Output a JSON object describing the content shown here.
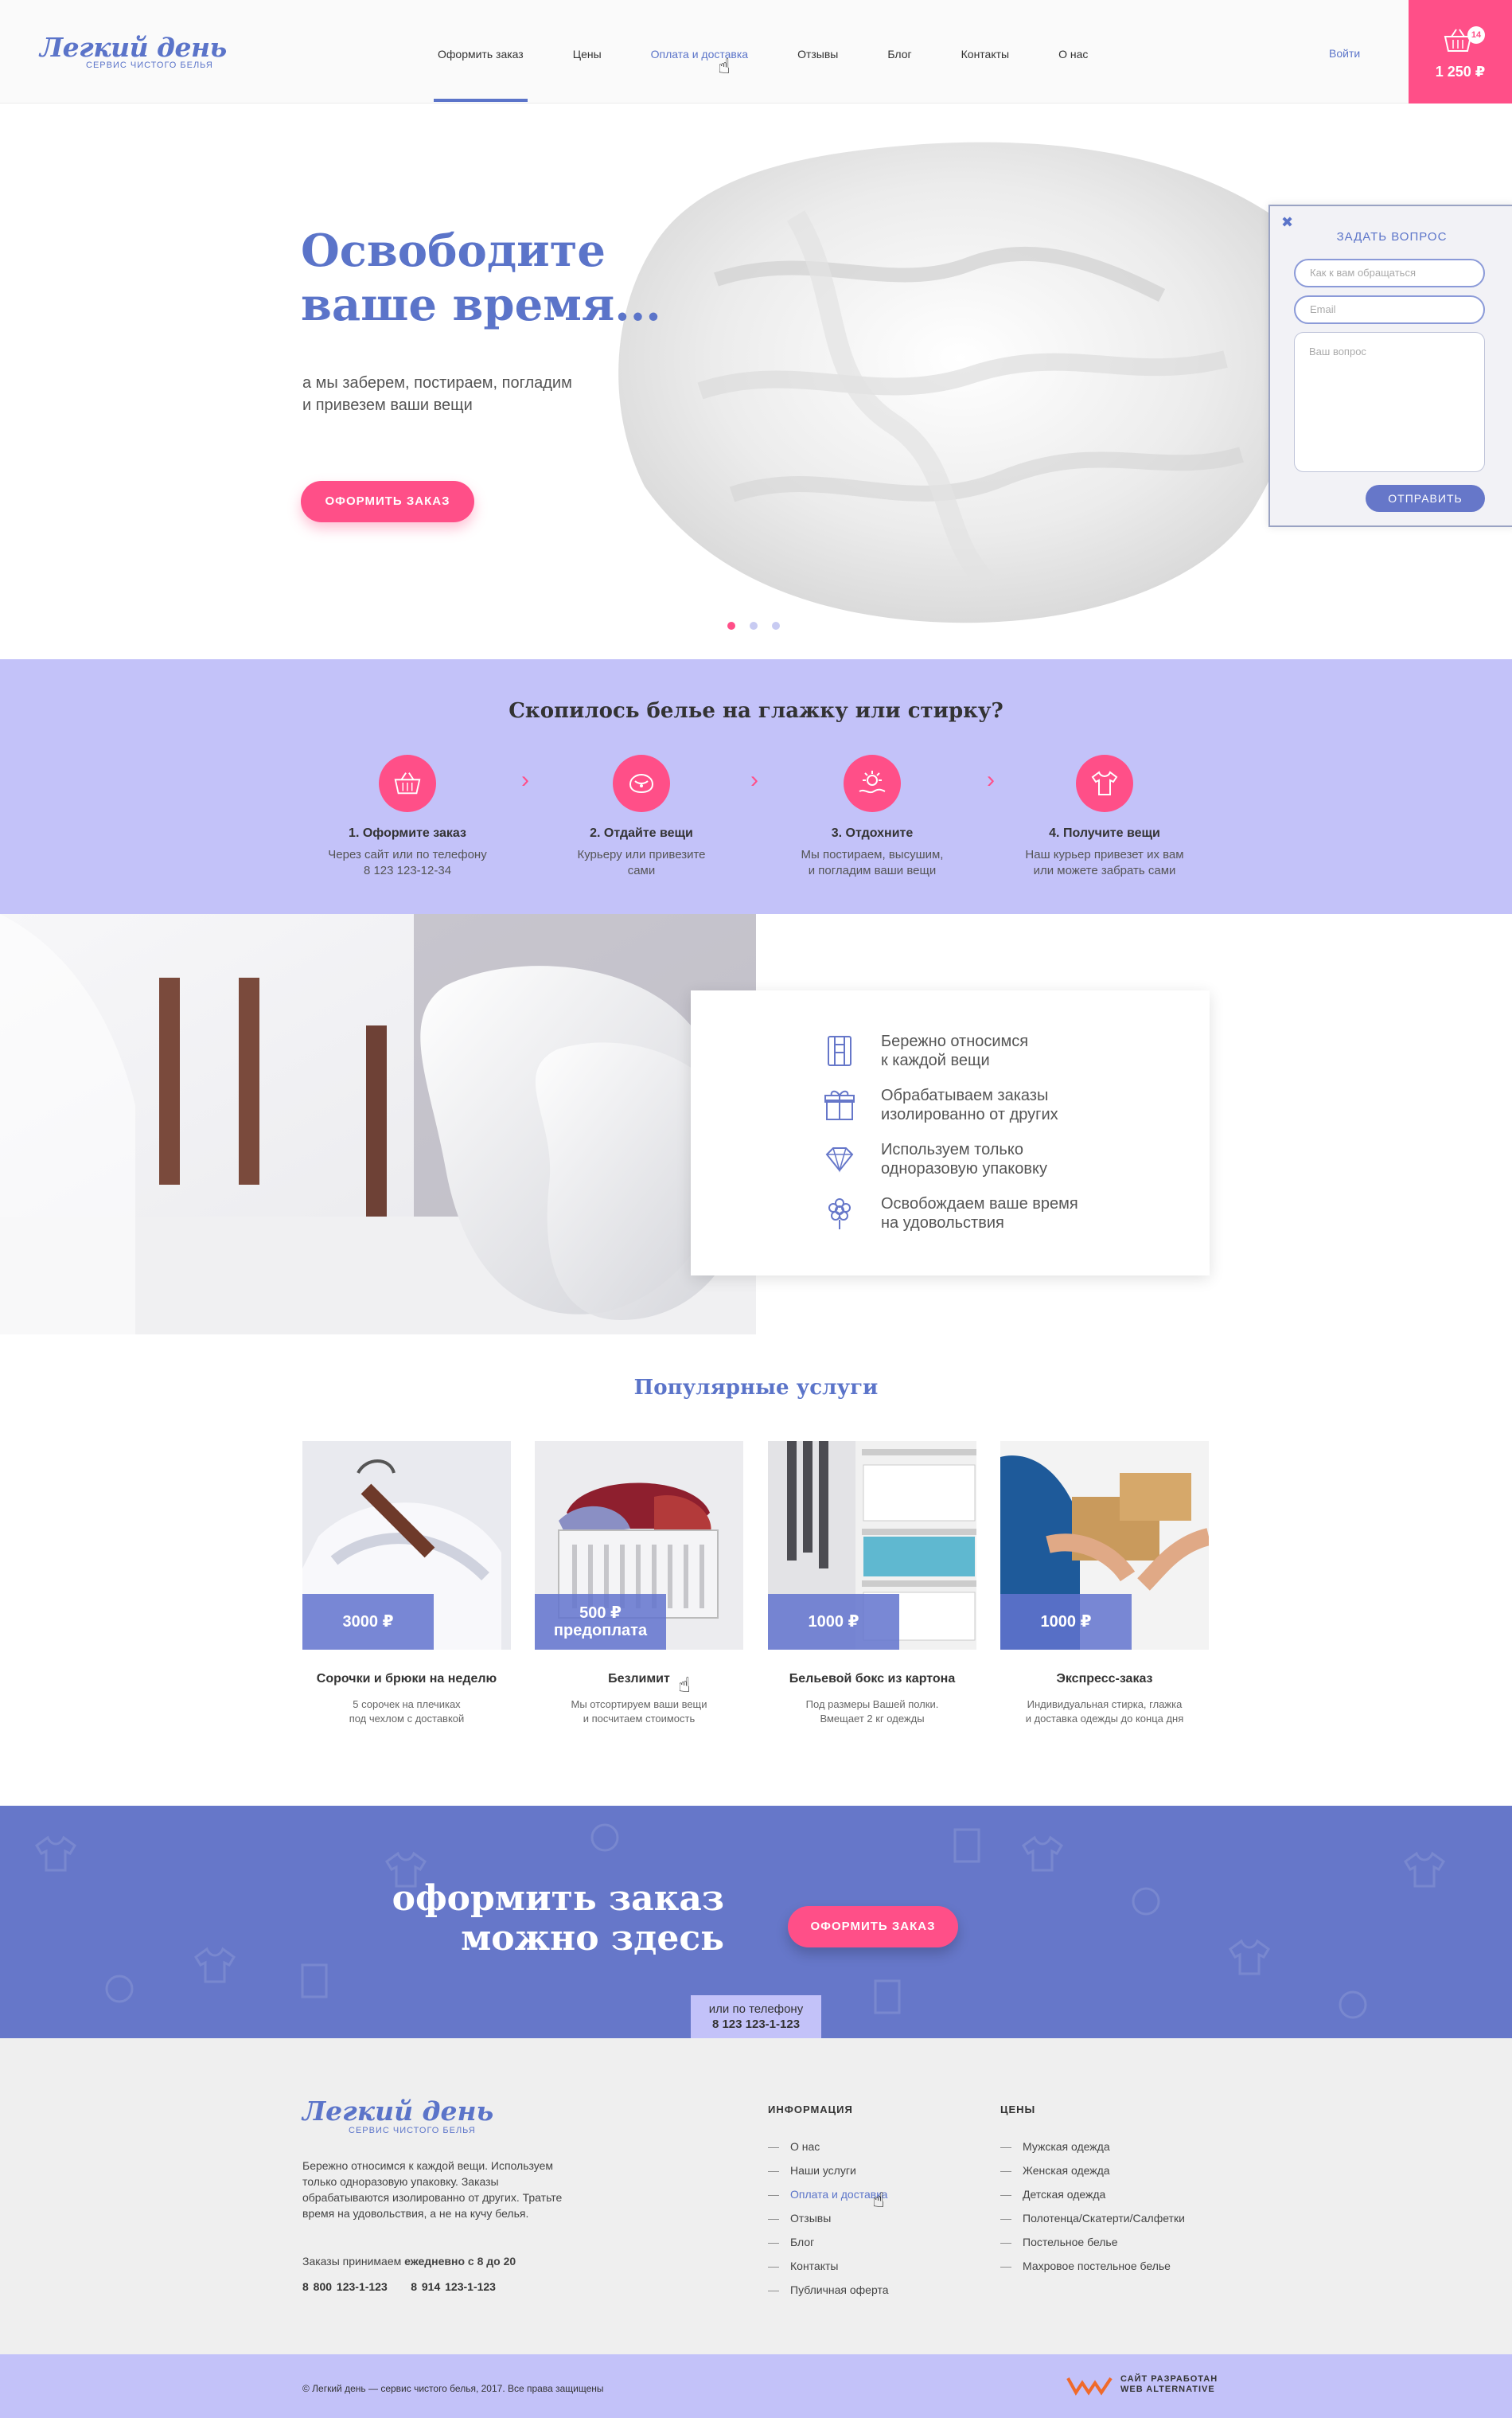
{
  "header": {
    "logo_title": "Легкий день",
    "logo_subtitle": "СЕРВИС ЧИСТОГО БЕЛЬЯ",
    "nav": [
      "Оформить заказ",
      "Цены",
      "Оплата и доставка",
      "Отзывы",
      "Блог",
      "Контакты",
      "О нас"
    ],
    "active_nav": "Оформить заказ",
    "hover_nav": "Оплата и доставка",
    "login": "Войти",
    "cart_count": "14",
    "cart_total": "1 250 ₽"
  },
  "hero": {
    "title_line1": "Освободите",
    "title_line2": "ваше время...",
    "subtitle_line1": "а мы заберем, постираем, погладим",
    "subtitle_line2": "и привезем ваши вещи",
    "button": "ОФОРМИТЬ ЗАКАЗ",
    "slides": 3,
    "active_slide": 1
  },
  "ask_form": {
    "title": "ЗАДАТЬ ВОПРОС",
    "name_placeholder": "Как к вам обращаться",
    "email_placeholder": "Email",
    "question_placeholder": "Ваш вопрос",
    "submit": "ОТПРАВИТЬ"
  },
  "how": {
    "title": "Скопилось белье на глажку или стирку?",
    "steps": [
      {
        "title": "1. Оформите заказ",
        "line1": "Через сайт или по телефону",
        "line2": "8 123 123-12-34",
        "icon": "basket-icon"
      },
      {
        "title": "2. Отдайте вещи",
        "line1": "Курьеру или привезите",
        "line2": "сами",
        "icon": "clothes-pile-icon"
      },
      {
        "title": "3. Отдохните",
        "line1": "Мы постираем, высушим,",
        "line2": "и погладим ваши вещи",
        "icon": "sun-relax-icon"
      },
      {
        "title": "4. Получите вещи",
        "line1": "Наш курьер привезет их вам",
        "line2": "или можете забрать сами",
        "icon": "shirt-icon"
      }
    ]
  },
  "features": [
    {
      "line1": "Бережно относимся",
      "line2": "к каждой вещи",
      "icon": "shirt-care-icon"
    },
    {
      "line1": "Обрабатываем заказы",
      "line2": "изолированно от других",
      "icon": "gift-box-icon"
    },
    {
      "line1": "Используем только",
      "line2": "одноразовую упаковку",
      "icon": "diamond-icon"
    },
    {
      "line1": "Освобождаем ваше время",
      "line2": "на удовольствия",
      "icon": "flower-icon"
    }
  ],
  "services": {
    "title": "Популярные услуги",
    "items": [
      {
        "price": "3000 ₽",
        "price2": "",
        "name": "Сорочки и брюки на неделю",
        "desc1": "5 сорочек на плечиках",
        "desc2": "под чехлом с доставкой"
      },
      {
        "price": "500 ₽",
        "price2": "предоплата",
        "name": "Безлимит",
        "desc1": "Мы отсортируем ваши вещи",
        "desc2": "и посчитаем стоимость"
      },
      {
        "price": "1000 ₽",
        "price2": "",
        "name": "Бельевой бокс из картона",
        "desc1": "Под размеры Вашей полки.",
        "desc2": "Вмещает 2 кг одежды"
      },
      {
        "price": "1000 ₽",
        "price2": "",
        "name": "Экспресс-заказ",
        "desc1": "Индивидуальная стирка, глажка",
        "desc2": "и доставка одежды до конца дня"
      }
    ]
  },
  "cta": {
    "line1": "оформить заказ",
    "line2": "можно здесь",
    "button": "ОФОРМИТЬ ЗАКАЗ",
    "phone_label": "или по телефону",
    "phone": "8 123 123-1-123"
  },
  "footer": {
    "logo_title": "Легкий день",
    "logo_subtitle": "СЕРВИС ЧИСТОГО БЕЛЬЯ",
    "about": "Бережно относимся к каждой вещи. Используем только одноразовую упаковку.  Заказы обрабатываются изолированно от других. Тратьте время на удовольствия, а не на кучу белья.",
    "hours_prefix": "Заказы  принимаем",
    "hours_bold": "ежедневно с 8 до 20",
    "phone1": "8 800 123-1-123",
    "phone2": "8 914  123-1-123",
    "info_title": "ИНФОРМАЦИЯ",
    "info_links": [
      "О нас",
      "Наши услуги",
      "Оплата и доставка",
      "Отзывы",
      "Блог",
      "Контакты",
      "Публичная оферта"
    ],
    "prices_title": "ЦЕНЫ",
    "price_links": [
      "Мужская одежда",
      "Женская одежда",
      "Детская одежда",
      "Полотенца/Скатерти/Салфетки",
      "Постельное белье",
      "Махровое постельное белье"
    ],
    "copyright": "© Легкий день — сервис чистого белья, 2017. Все права защищены",
    "dev_line1": "САЙТ РАЗРАБОТАН",
    "dev_line2": "WEB ALTERNATIVE"
  },
  "colors": {
    "accent": "#ff4f88",
    "brand": "#5b74c9",
    "lavender": "#c3c2f9",
    "cta_bg": "#6677c9"
  }
}
